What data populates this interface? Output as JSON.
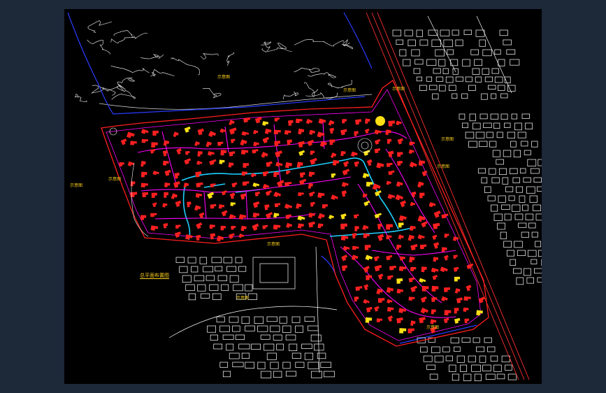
{
  "canvas": {
    "background": "#000000",
    "frame_background": "#1d2838"
  },
  "colors": {
    "boundary": "#ff1e1e",
    "site_road": "#ff00ff",
    "water": "#1ecfff",
    "building": "#ff2020",
    "building_highlight": "#ffe014",
    "context": "#ffffff",
    "edge_line": "#2a3cff",
    "label": "#ffd21a"
  },
  "labels": {
    "title": "总平面布置图",
    "tag_a": "示意图",
    "tag_b": "示意图",
    "tag_c": "示意图",
    "tag_d": "示意图",
    "tag_e": "示意图",
    "tag_f": "示意图",
    "tag_g": "示意图",
    "tag_h": "示意图",
    "tag_i": "示意图",
    "tag_j": "示意图"
  }
}
